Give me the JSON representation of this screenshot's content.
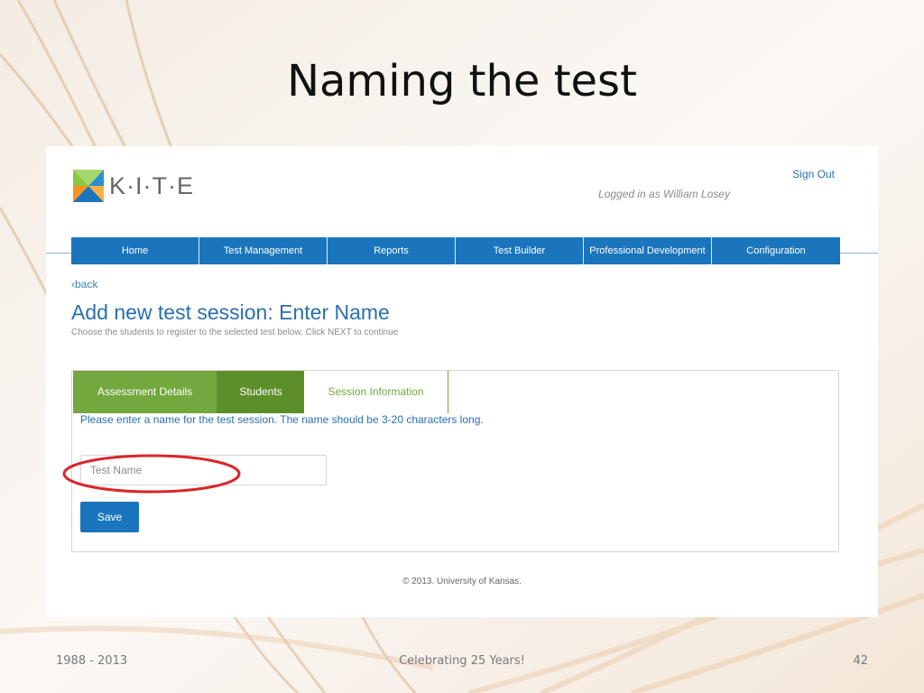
{
  "slide": {
    "title": "Naming the test",
    "footer_left": "1988 - 2013",
    "footer_center": "Celebrating 25 Years!",
    "footer_right": "42"
  },
  "app": {
    "logo_text": "K·I·T·E",
    "sign_out": "Sign Out",
    "logged_in": "Logged in as William Losey",
    "nav": [
      {
        "label": "Home"
      },
      {
        "label": "Test Management"
      },
      {
        "label": "Reports"
      },
      {
        "label": "Test Builder"
      },
      {
        "label": "Professional Development"
      },
      {
        "label": "Configuration"
      }
    ],
    "back_link": "‹back",
    "page_title": "Add new test session: Enter Name",
    "subtitle": "Choose the students to register to the selected test below. Click NEXT to continue",
    "tabs": [
      {
        "label": "Assessment Details"
      },
      {
        "label": "Students"
      },
      {
        "label": "Session Information"
      }
    ],
    "instructions": "Please enter a name for the test session. The name should be 3-20 characters long.",
    "test_name_input": {
      "placeholder": "Test Name",
      "value": ""
    },
    "save_label": "Save",
    "copyright": "© 2013. University of Kansas."
  },
  "colors": {
    "nav_blue": "#1b75bc",
    "tab_green": "#72a83d",
    "highlight_red": "#d9262b"
  }
}
